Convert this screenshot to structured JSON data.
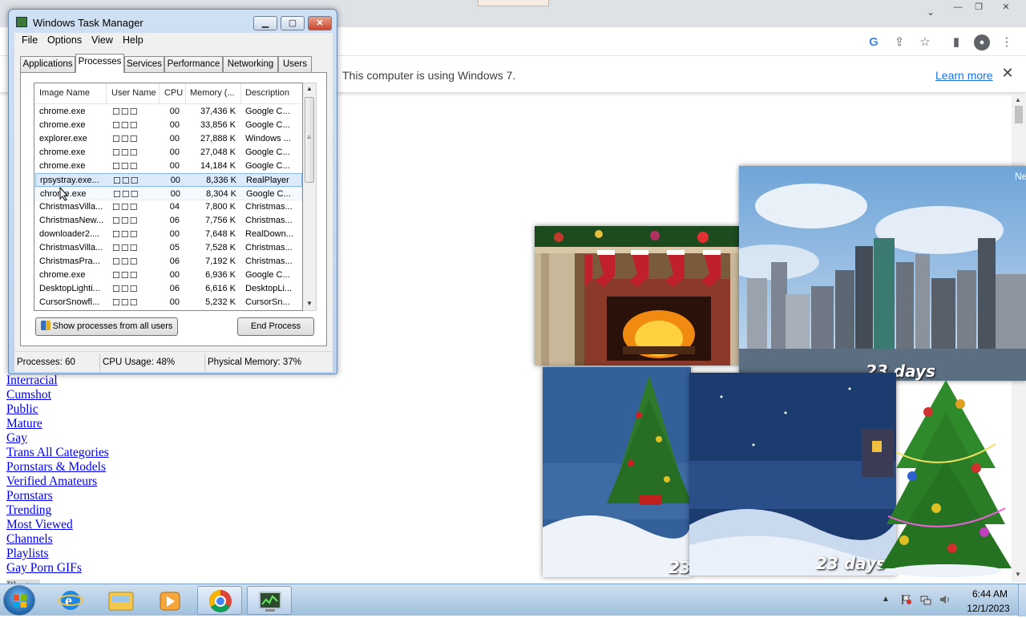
{
  "browser": {
    "infobar_text": "This computer is using Windows 7.",
    "learn_more": "Learn more",
    "close_glyph": "✕"
  },
  "page_links": [
    "Interracial",
    "Cumshot",
    "Public",
    "Mature",
    "Gay",
    "Trans All Categories",
    "Pornstars & Models",
    "Verified Amateurs",
    "Pornstars",
    "Trending",
    "Most Viewed",
    "Channels",
    "Playlists",
    "Gay Porn GIFs"
  ],
  "page_link_partial": "Photos",
  "gadgets": {
    "city_days": "23 days",
    "village_days": "23 days",
    "left_days_partial": "23",
    "city_corner_text": "Ne"
  },
  "taskmgr": {
    "title": "Windows Task Manager",
    "menu": [
      "File",
      "Options",
      "View",
      "Help"
    ],
    "tabs": [
      "Applications",
      "Processes",
      "Services",
      "Performance",
      "Networking",
      "Users"
    ],
    "active_tab": "Processes",
    "columns": [
      "Image Name",
      "User Name",
      "CPU",
      "Memory (...",
      "Description"
    ],
    "rows": [
      {
        "name": "chrome.exe",
        "user": "☐☐☐",
        "cpu": "00",
        "mem": "37,436 K",
        "desc": "Google C..."
      },
      {
        "name": "chrome.exe",
        "user": "☐☐☐",
        "cpu": "00",
        "mem": "33,856 K",
        "desc": "Google C..."
      },
      {
        "name": "explorer.exe",
        "user": "☐☐☐",
        "cpu": "00",
        "mem": "27,888 K",
        "desc": "Windows ..."
      },
      {
        "name": "chrome.exe",
        "user": "☐☐☐",
        "cpu": "00",
        "mem": "27,048 K",
        "desc": "Google C..."
      },
      {
        "name": "chrome.exe",
        "user": "☐☐☐",
        "cpu": "00",
        "mem": "14,184 K",
        "desc": "Google C..."
      },
      {
        "name": "rpsystray.exe...",
        "user": "☐☐☐",
        "cpu": "00",
        "mem": "8,336 K",
        "desc": "RealPlayer"
      },
      {
        "name": "chrome.exe",
        "user": "☐☐☐",
        "cpu": "00",
        "mem": "8,304 K",
        "desc": "Google C..."
      },
      {
        "name": "ChristmasVilla...",
        "user": "☐☐☐",
        "cpu": "04",
        "mem": "7,800 K",
        "desc": "Christmas..."
      },
      {
        "name": "ChristmasNew...",
        "user": "☐☐☐",
        "cpu": "06",
        "mem": "7,756 K",
        "desc": "Christmas..."
      },
      {
        "name": "downloader2....",
        "user": "☐☐☐",
        "cpu": "00",
        "mem": "7,648 K",
        "desc": "RealDown..."
      },
      {
        "name": "ChristmasVilla...",
        "user": "☐☐☐",
        "cpu": "05",
        "mem": "7,528 K",
        "desc": "Christmas..."
      },
      {
        "name": "ChristmasPra...",
        "user": "☐☐☐",
        "cpu": "06",
        "mem": "7,192 K",
        "desc": "Christmas..."
      },
      {
        "name": "chrome.exe",
        "user": "☐☐☐",
        "cpu": "00",
        "mem": "6,936 K",
        "desc": "Google C..."
      },
      {
        "name": "DesktopLighti...",
        "user": "☐☐☐",
        "cpu": "06",
        "mem": "6,616 K",
        "desc": "DesktopLi..."
      },
      {
        "name": "CursorSnowfl...",
        "user": "☐☐☐",
        "cpu": "00",
        "mem": "5,232 K",
        "desc": "CursorSn..."
      }
    ],
    "selected_row": 5,
    "hover_row": 6,
    "show_all_button": "Show processes from all users",
    "end_process_button": "End Process",
    "status": {
      "processes": "Processes: 60",
      "cpu": "CPU Usage: 48%",
      "memory": "Physical Memory: 37%"
    }
  },
  "taskbar": {
    "apps": [
      "internet-explorer",
      "windows-explorer",
      "media-player",
      "chrome",
      "task-manager"
    ],
    "clock_time": "6:44 AM",
    "clock_date": "12/1/2023"
  },
  "colors": {
    "link": "#0000ee",
    "learn_more": "#1a73e8",
    "selection": "#dcebfc"
  }
}
